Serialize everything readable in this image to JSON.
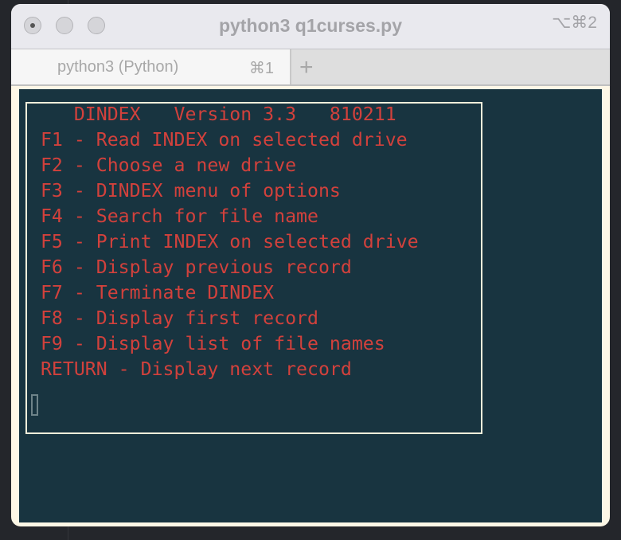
{
  "window": {
    "title": "python3 q1curses.py",
    "shortcut": "⌥⌘2"
  },
  "tabs": [
    {
      "label": "python3 (Python)",
      "shortcut": "⌘1"
    }
  ],
  "new_tab_label": "+",
  "terminal": {
    "lines": [
      "    DINDEX   Version 3.3   810211",
      " F1 - Read INDEX on selected drive",
      " F2 - Choose a new drive",
      " F3 - DINDEX menu of options",
      " F4 - Search for file name",
      " F5 - Print INDEX on selected drive",
      " F6 - Display previous record",
      " F7 - Terminate DINDEX",
      " F8 - Display first record",
      " F9 - Display list of file names",
      " RETURN - Display next record"
    ],
    "text_color": "#d2413c",
    "background": "#183440"
  }
}
